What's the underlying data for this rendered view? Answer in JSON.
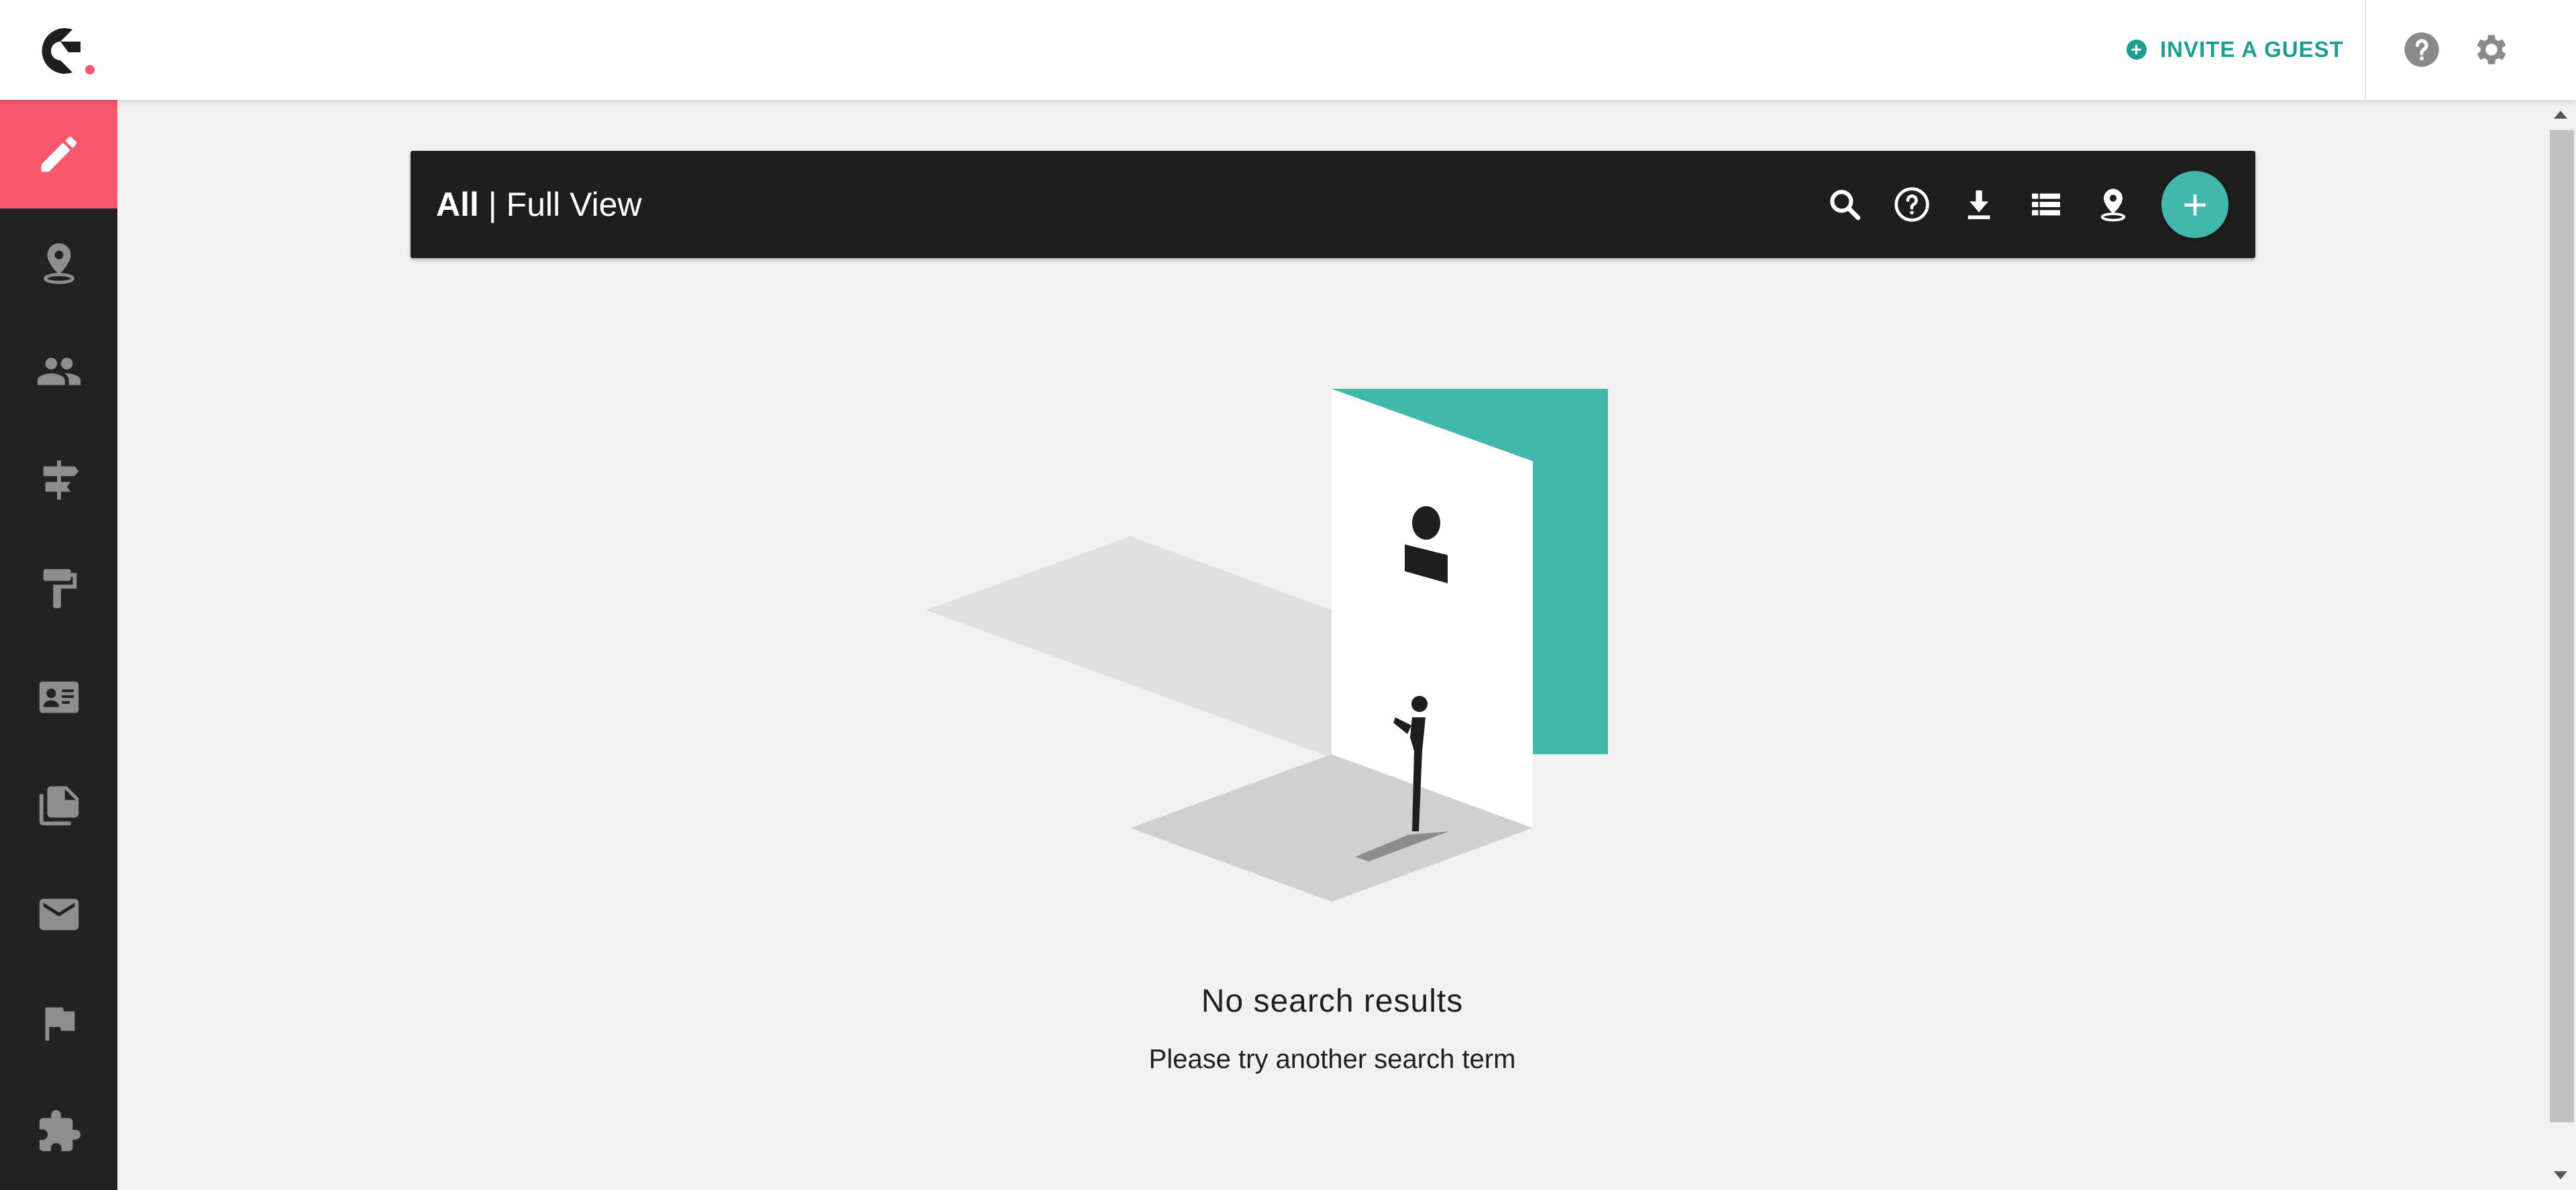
{
  "header": {
    "invite_label": "INVITE A GUEST",
    "invite_icon": "plus-circle-icon",
    "help_icon": "help-circle-icon",
    "settings_icon": "gear-icon",
    "accent_color": "#1f9e8f"
  },
  "sidebar": {
    "active_color": "#f7576c",
    "items": [
      {
        "icon": "pencil-icon",
        "active": true
      },
      {
        "icon": "map-pin-icon"
      },
      {
        "icon": "people-icon"
      },
      {
        "icon": "signpost-icon"
      },
      {
        "icon": "paint-roller-icon"
      },
      {
        "icon": "id-card-icon"
      },
      {
        "icon": "documents-icon"
      },
      {
        "icon": "mail-icon"
      },
      {
        "icon": "flag-icon"
      },
      {
        "icon": "puzzle-icon"
      }
    ]
  },
  "toolbar": {
    "title_bold": "All",
    "title_rest": " | Full View",
    "icons": [
      "search-icon",
      "help-icon",
      "download-icon",
      "list-view-icon",
      "map-view-icon"
    ],
    "add_label": "+",
    "fab_color": "#40b8ac"
  },
  "empty_state": {
    "title": "No search results",
    "subtitle": "Please try another search term"
  }
}
